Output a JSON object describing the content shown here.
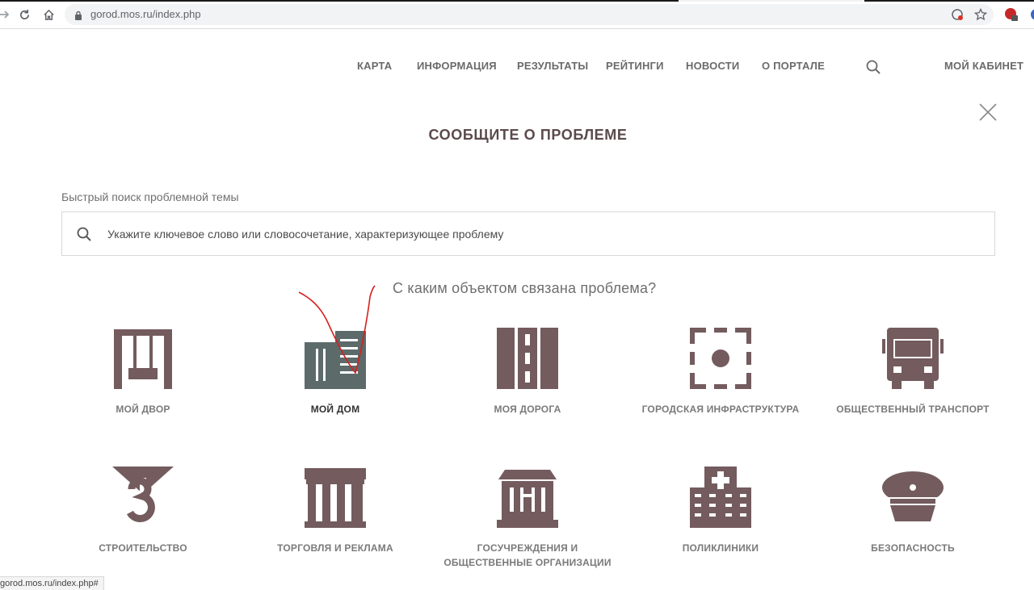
{
  "browser": {
    "url": "gorod.mos.ru/index.php",
    "status_url": "gorod.mos.ru/index.php#"
  },
  "nav": {
    "items": [
      "КАРТА",
      "ИНФОРМАЦИЯ",
      "РЕЗУЛЬТАТЫ",
      "РЕЙТИНГИ",
      "НОВОСТИ",
      "О ПОРТАЛЕ"
    ],
    "cabinet": "МОЙ КАБИНЕТ"
  },
  "page": {
    "title": "СООБЩИТЕ О ПРОБЛЕМЕ",
    "search_label": "Быстрый поиск проблемной темы",
    "search_placeholder": "Укажите ключевое слово или словосочетание, характеризующее проблему",
    "question": "С каким объектом связана проблема?"
  },
  "categories": [
    {
      "label": "МОЙ ДВОР",
      "icon": "swing-icon"
    },
    {
      "label": "МОЙ ДОМ",
      "icon": "house-icon",
      "active": true
    },
    {
      "label": "МОЯ ДОРОГА",
      "icon": "road-icon"
    },
    {
      "label": "ГОРОДСКАЯ ИНФРАСТРУКТУРА",
      "icon": "infrastructure-icon"
    },
    {
      "label": "ОБЩЕСТВЕННЫЙ ТРАНСПОРТ",
      "icon": "bus-icon"
    },
    {
      "label": "СТРОИТЕЛЬСТВО",
      "icon": "crane-hook-icon"
    },
    {
      "label": "ТОРГОВЛЯ И РЕКЛАМА",
      "icon": "shop-icon"
    },
    {
      "label_line1": "ГОСУЧРЕЖДЕНИЯ И",
      "label_line2": "ОБЩЕСТВЕННЫЕ ОРГАНИЗАЦИИ",
      "icon": "government-building-icon"
    },
    {
      "label": "ПОЛИКЛИНИКИ",
      "icon": "hospital-icon"
    },
    {
      "label": "БЕЗОПАСНОСТЬ",
      "icon": "police-cap-icon"
    }
  ],
  "colors": {
    "icon": "#735b5e",
    "active_icon": "#5c6a6a",
    "annotation": "#d62020"
  }
}
